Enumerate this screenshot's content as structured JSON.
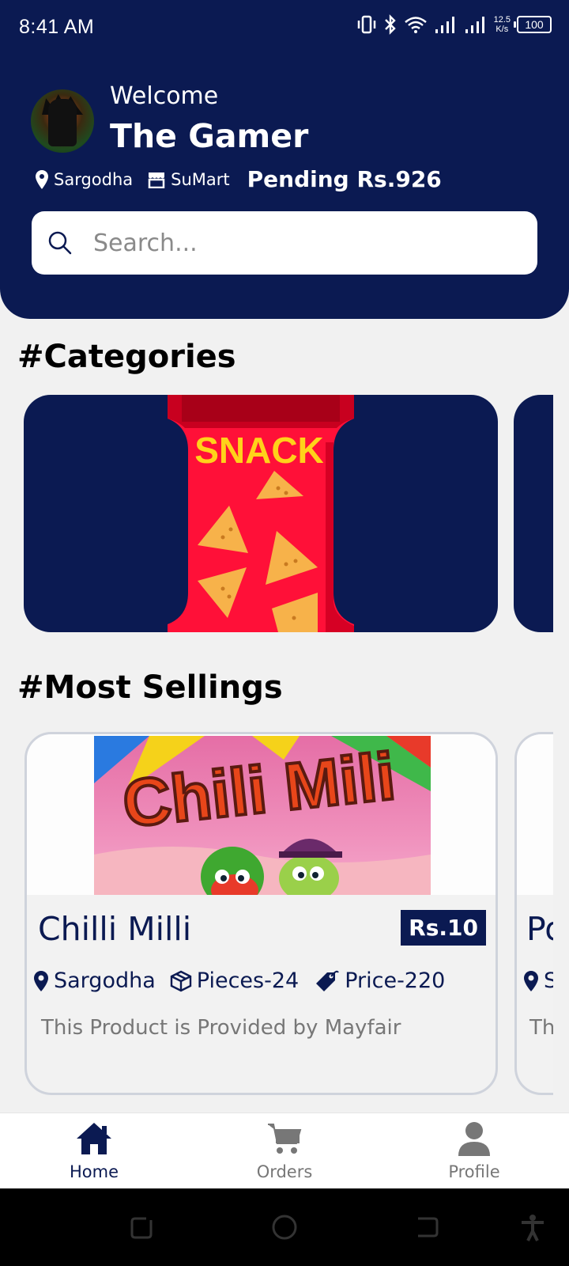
{
  "status_bar": {
    "time": "8:41 AM",
    "net_speed_value": "12.5",
    "net_speed_unit": "K/s",
    "battery": "100"
  },
  "header": {
    "welcome": "Welcome",
    "username": "The Gamer",
    "location": "Sargodha",
    "store": "SuMart",
    "pending": "Pending Rs.926"
  },
  "search": {
    "placeholder": "Search..."
  },
  "categories": {
    "title": "#Categories",
    "items": [
      {
        "label": "SNACK"
      }
    ]
  },
  "most_sellings": {
    "title": "#Most Sellings",
    "products": [
      {
        "image_text": "Chili Mili",
        "name": "Chilli Milli",
        "price": "Rs.10",
        "location": "Sargodha",
        "pieces": "Pieces-24",
        "total_price": "Price-220",
        "description": "This Product is Provided by Mayfair"
      },
      {
        "name": "Po",
        "location": "S",
        "description": "Th"
      }
    ]
  },
  "bottom_nav": {
    "items": [
      {
        "label": "Home"
      },
      {
        "label": "Orders"
      },
      {
        "label": "Profile"
      }
    ]
  },
  "colors": {
    "primary": "#0b1a52",
    "background": "#f1f1f1",
    "inactive": "#777777"
  }
}
